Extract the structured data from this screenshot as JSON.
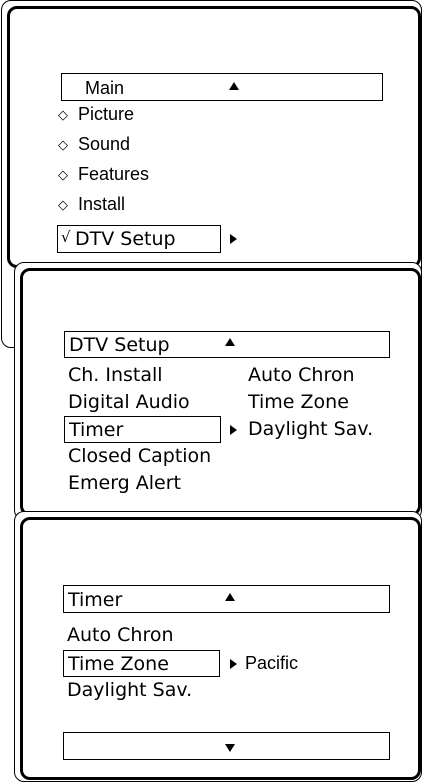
{
  "panel1": {
    "header": "Main",
    "items": [
      "Picture",
      "Sound",
      "Features",
      "Install"
    ],
    "item_marker": "◇",
    "selected": "DTV Setup",
    "selected_marker": "√"
  },
  "panel2": {
    "header": "DTV Setup",
    "left_items": [
      "Ch. Install",
      "Digital Audio",
      "Timer",
      "Closed Caption",
      "Emerg Alert"
    ],
    "right_items": [
      "Auto Chron",
      "Time Zone",
      "Daylight Sav."
    ]
  },
  "panel3": {
    "header": "Timer",
    "items": [
      "Auto Chron",
      "Time Zone",
      "Daylight Sav."
    ],
    "value": "Pacific"
  }
}
